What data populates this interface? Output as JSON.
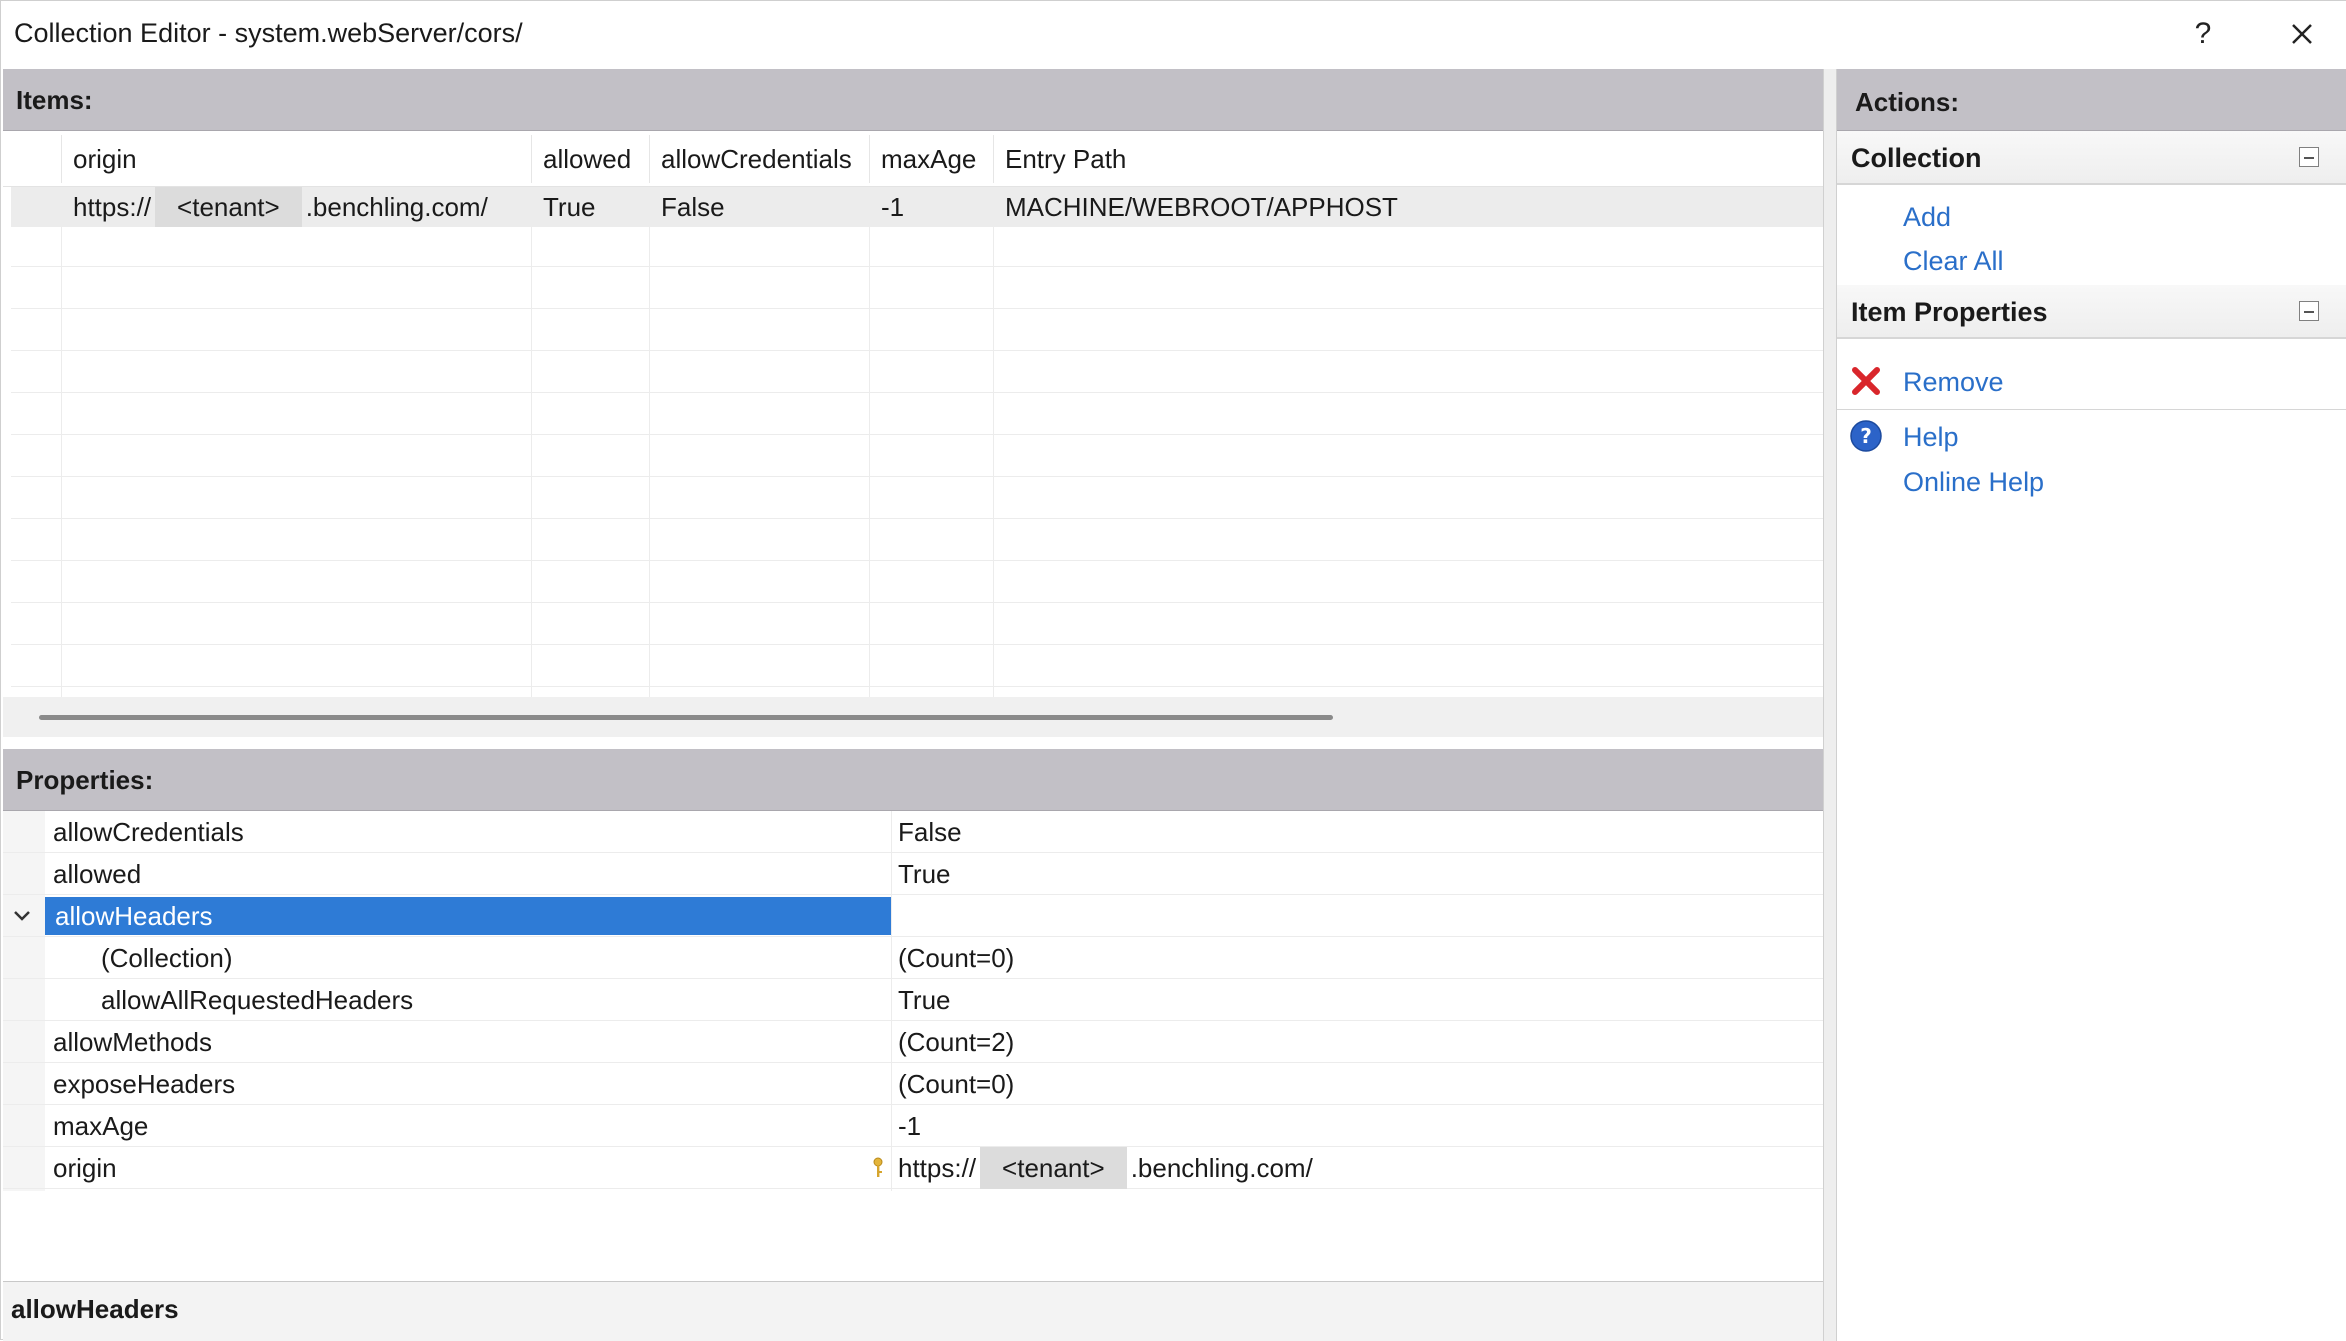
{
  "window": {
    "title": "Collection Editor - system.webServer/cors/",
    "help_glyph": "?",
    "close_icon": "close-icon"
  },
  "items": {
    "header": "Items:",
    "columns": [
      "origin",
      "allowed",
      "allowCredentials",
      "maxAge",
      "Entry Path"
    ],
    "rows": [
      {
        "origin_prefix": "https://",
        "origin_redacted": "<tenant>",
        "origin_suffix": ".benchling.com/",
        "allowed": "True",
        "allowCredentials": "False",
        "maxAge": "-1",
        "entryPath": "MACHINE/WEBROOT/APPHOST"
      }
    ]
  },
  "properties": {
    "header": "Properties:",
    "rows": [
      {
        "name": "allowCredentials",
        "value": "False"
      },
      {
        "name": "allowed",
        "value": "True"
      },
      {
        "name": "allowHeaders",
        "value": ""
      },
      {
        "name": "(Collection)",
        "value": "(Count=0)"
      },
      {
        "name": "allowAllRequestedHeaders",
        "value": "True"
      },
      {
        "name": "allowMethods",
        "value": "(Count=2)"
      },
      {
        "name": "exposeHeaders",
        "value": "(Count=0)"
      },
      {
        "name": "maxAge",
        "value": "-1"
      },
      {
        "name": "origin",
        "value_prefix": "https://",
        "value_redacted": "<tenant>",
        "value_suffix": ".benchling.com/"
      }
    ],
    "selected": "allowHeaders",
    "description_title": "allowHeaders"
  },
  "actions": {
    "header": "Actions:",
    "groups": [
      {
        "title": "Collection",
        "links": [
          "Add",
          "Clear All"
        ]
      },
      {
        "title": "Item Properties",
        "links": [
          "Remove",
          "Help",
          "Online Help"
        ]
      }
    ],
    "icons": {
      "remove": "remove-x-icon",
      "help": "help-question-icon"
    }
  },
  "colors": {
    "selection": "#2e7bd6",
    "link": "#2a6fc9",
    "header_bg": "#c2c0c6",
    "remove_icon": "#d9262b",
    "help_icon": "#2c63c8"
  }
}
